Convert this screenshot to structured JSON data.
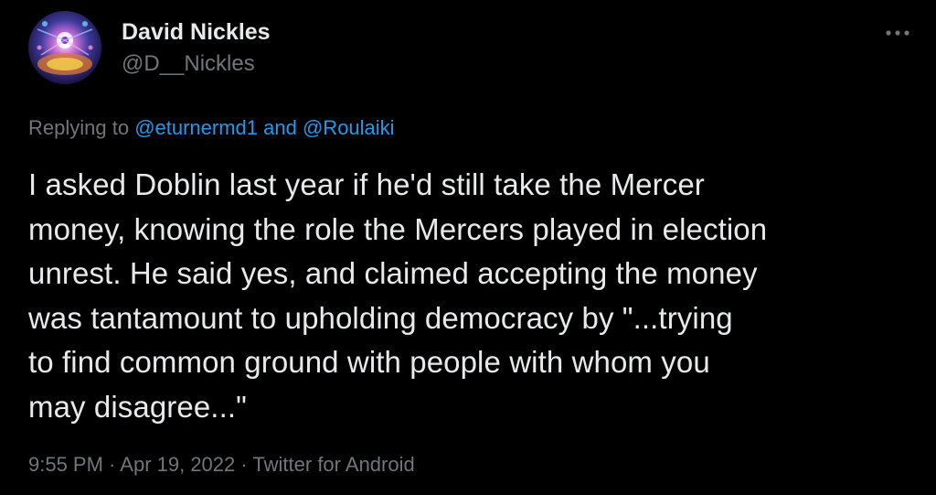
{
  "tweet": {
    "author": {
      "display_name": "David Nickles",
      "handle": "@D__Nickles"
    },
    "more_glyph": "•••",
    "replying_to": {
      "prefix": "Replying to ",
      "user1": "@eturnermd1",
      "conjunction": " and ",
      "user2": "@Roulaiki"
    },
    "text_lines": [
      "I asked Doblin last year if he'd still take the Mercer",
      "money, knowing the role the Mercers played in election",
      "unrest. He said yes, and claimed accepting the money",
      "was tantamount to upholding democracy by \"...trying",
      "to find common ground with people with whom you",
      "may disagree...\""
    ],
    "time": "9:55 PM",
    "separator": " · ",
    "date": "Apr 19, 2022",
    "source": "Twitter for Android"
  },
  "colors": {
    "background": "#000000",
    "primary_text": "#e7e9ea",
    "secondary_text": "#71767b",
    "link": "#1d9bf0"
  },
  "icons": {
    "more": "more-horizontal-icon",
    "avatar": "avatar-image"
  }
}
